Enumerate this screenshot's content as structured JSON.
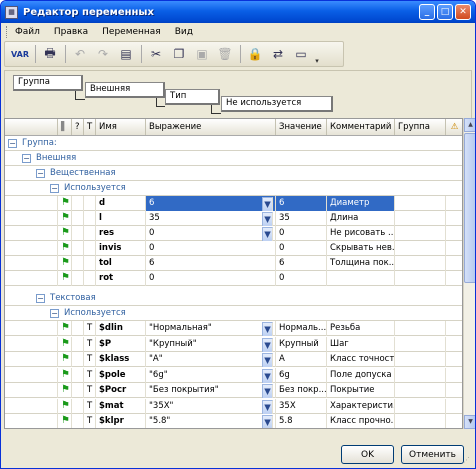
{
  "window": {
    "title": "Редактор переменных",
    "buttons": [
      "_",
      "□",
      "✕"
    ]
  },
  "menu": [
    "Файл",
    "Правка",
    "Переменная",
    "Вид"
  ],
  "toolbar": {
    "var_label": "VAR"
  },
  "groupby": [
    "Группа",
    "Внешняя",
    "Тип",
    "Не используется"
  ],
  "columns": [
    "Имя",
    "Выражение",
    "Значение",
    "Комментарий",
    "Группа"
  ],
  "col_q": "?",
  "col_t": "T",
  "groups": {
    "root": "Группа:",
    "ext": "Внешняя",
    "real": "Вещественная",
    "used1": "Используется",
    "text": "Текстовая",
    "used2": "Используется"
  },
  "real_rows": [
    {
      "name": "d",
      "expr": "6",
      "value": "6",
      "comment": "Диаметр",
      "selected": true,
      "dropdown": true
    },
    {
      "name": "l",
      "expr": "35",
      "value": "35",
      "comment": "Длина",
      "selected": false,
      "dropdown": true
    },
    {
      "name": "res",
      "expr": "0",
      "value": "0",
      "comment": "Не рисовать ...",
      "selected": false,
      "dropdown": true
    },
    {
      "name": "invis",
      "expr": "0",
      "value": "0",
      "comment": "Скрывать нев...",
      "selected": false,
      "dropdown": false
    },
    {
      "name": "tol",
      "expr": "6",
      "value": "6",
      "comment": "Толщина пок...",
      "selected": false,
      "dropdown": false
    },
    {
      "name": "rot",
      "expr": "0",
      "value": "0",
      "comment": "",
      "selected": false,
      "dropdown": false
    }
  ],
  "text_rows": [
    {
      "name": "$dlin",
      "expr": "\"Нормальная\"",
      "value": "Нормаль...",
      "comment": "Резьба"
    },
    {
      "name": "$P",
      "expr": "\"Крупный\"",
      "value": "Крупный",
      "comment": "Шаг"
    },
    {
      "name": "$klass",
      "expr": "\"A\"",
      "value": "A",
      "comment": "Класс точности"
    },
    {
      "name": "$pole",
      "expr": "\"6g\"",
      "value": "6g",
      "comment": "Поле допуска"
    },
    {
      "name": "$Pocr",
      "expr": "\"Без покрытия\"",
      "value": "Без покр...",
      "comment": "Покрытие"
    },
    {
      "name": "$mat",
      "expr": "\"35X\"",
      "value": "35X",
      "comment": "Характеристи..."
    },
    {
      "name": "$klpr",
      "expr": "\"5.8\"",
      "value": "5.8",
      "comment": "Класс прочно..."
    }
  ],
  "buttons": {
    "ok": "OK",
    "cancel": "Отменить"
  }
}
